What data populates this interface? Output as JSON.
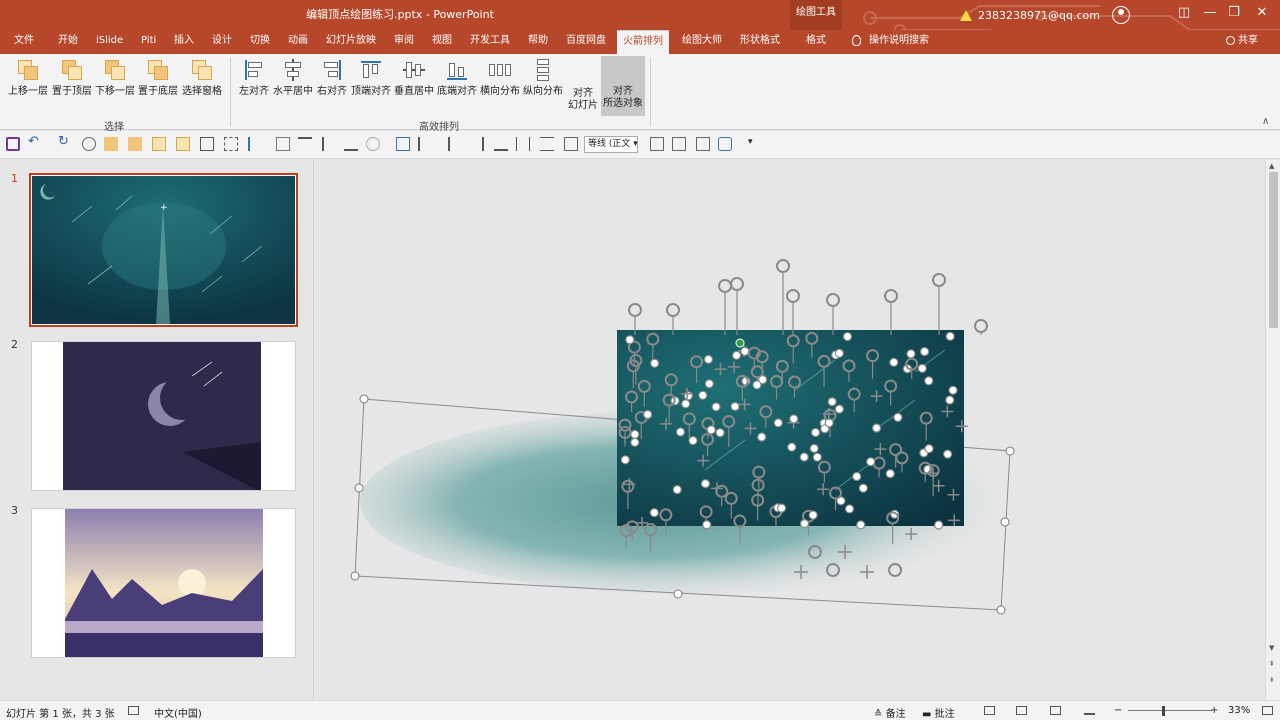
{
  "window": {
    "title": "编辑顶点绘图练习.pptx  -  PowerPoint",
    "tools_tag": "绘图工具",
    "account": "2383238971@qq.com",
    "controls": [
      "—",
      "❐",
      "✕",
      "◫"
    ]
  },
  "tabs": [
    {
      "label": "文件",
      "active": false
    },
    {
      "label": "开始",
      "active": false
    },
    {
      "label": "iSlide",
      "active": false
    },
    {
      "label": "Piti",
      "active": false
    },
    {
      "label": "插入",
      "active": false
    },
    {
      "label": "设计",
      "active": false
    },
    {
      "label": "切换",
      "active": false
    },
    {
      "label": "动画",
      "active": false
    },
    {
      "label": "幻灯片放映",
      "active": false
    },
    {
      "label": "审阅",
      "active": false
    },
    {
      "label": "视图",
      "active": false
    },
    {
      "label": "开发工具",
      "active": false
    },
    {
      "label": "帮助",
      "active": false
    },
    {
      "label": "百度网盘",
      "active": false
    },
    {
      "label": "火箭排列",
      "active": true
    },
    {
      "label": "绘图大师",
      "active": false
    },
    {
      "label": "形状格式",
      "active": false
    },
    {
      "label": "格式",
      "active": false
    }
  ],
  "help_search": "操作说明搜索",
  "share": "共享",
  "ribbon": {
    "groups": [
      {
        "label": "选择",
        "buttons": [
          "上移一层",
          "置于顶层",
          "下移一层",
          "置于底层",
          "选择窗格"
        ]
      },
      {
        "label": "高效排列",
        "buttons": [
          "左对齐",
          "水平居中",
          "右对齐",
          "顶端对齐",
          "垂直居中",
          "底端对齐",
          "横向分布",
          "纵向分布",
          "对齐\n幻灯片",
          "对齐\n所选对象"
        ]
      }
    ]
  },
  "qat": {
    "font_box": "等线 (正文"
  },
  "slides": [
    {
      "number": "1",
      "selected": true
    },
    {
      "number": "2",
      "selected": false
    },
    {
      "number": "3",
      "selected": false
    }
  ],
  "status": {
    "slide_info": "幻灯片 第 1 张，共 3 张",
    "language": "中文(中国)",
    "notes": "备注",
    "comments": "批注",
    "zoom_minus": "−",
    "zoom_plus": "+",
    "zoom": "33%",
    "zoom_fraction": 0.33
  },
  "colors": {
    "title_bar": "#b7472a",
    "active_tab_text": "#b7472a",
    "slide_teal_dark": "#0f3a47",
    "slide_teal_light": "#1d6a70",
    "ellipse_teal": "#6aa6a4"
  }
}
